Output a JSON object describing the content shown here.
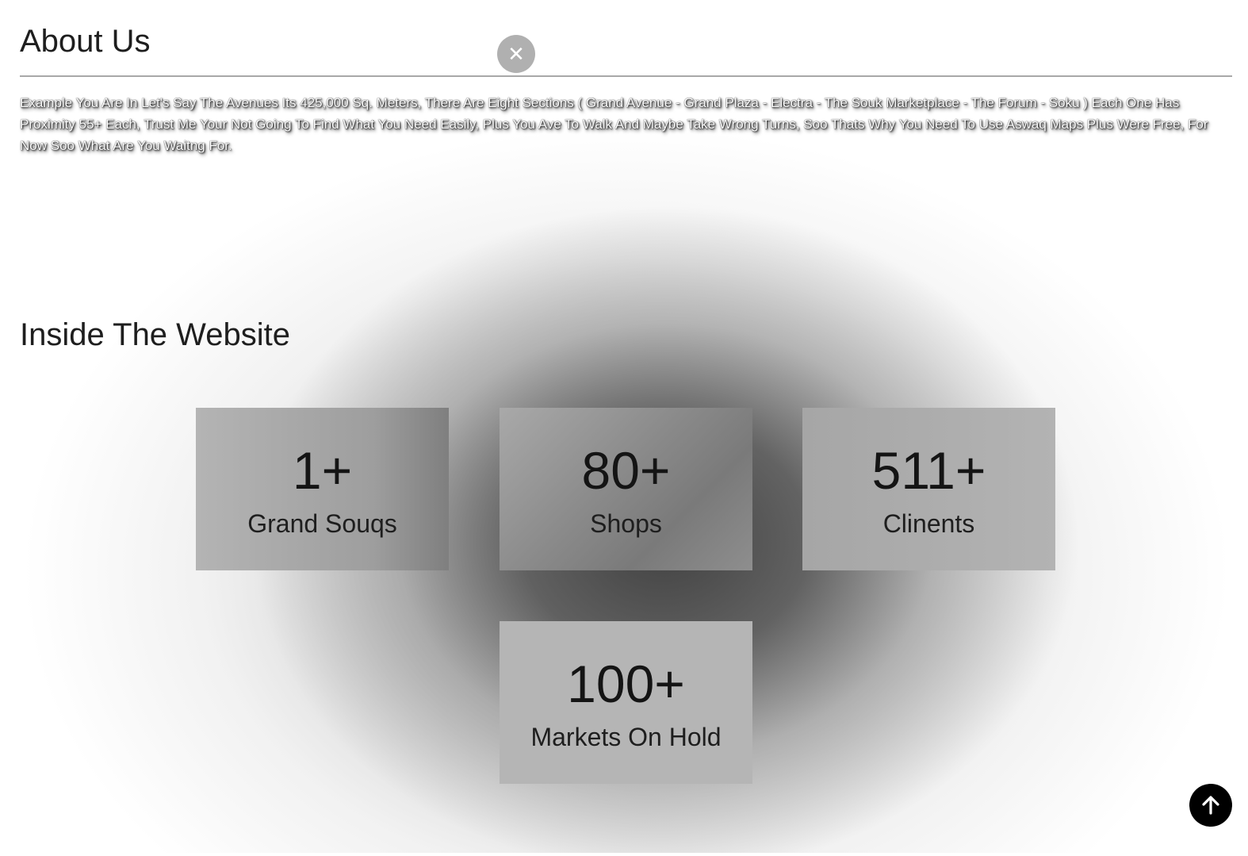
{
  "about": {
    "title": "About Us",
    "text": "Example You Are In Let's Say The Avenues Its 425,000 Sq. Meters, There Are Eight Sections ( Grand Avenue - Grand Plaza - Electra - The Souk Marketplace - The Forum - Soku ) Each One Has Proximity 55+ Each, Trust Me Your Not Going To Find What You Need Easily, Plus You Ave To Walk And Maybe Take Wrong Turns, Soo Thats Why You Need To Use Aswaq Maps Plus Were Free, For Now Soo What Are You Waitng For."
  },
  "close_button": {
    "icon": "close-icon",
    "glyph": "✕"
  },
  "inside": {
    "title": "Inside The Website",
    "stats": [
      {
        "number": "1+",
        "label": "Grand Souqs"
      },
      {
        "number": "80+",
        "label": "Shops"
      },
      {
        "number": "511+",
        "label": "Clinents"
      },
      {
        "number": "100+",
        "label": "Markets On Hold"
      }
    ]
  },
  "scroll_top": {
    "icon": "arrow-up-icon"
  },
  "colors": {
    "card_bg": "#b3b3b3",
    "text_dark": "#1e1e1e",
    "close_bg": "#b0b0b0",
    "scroll_top_bg": "#000000"
  }
}
